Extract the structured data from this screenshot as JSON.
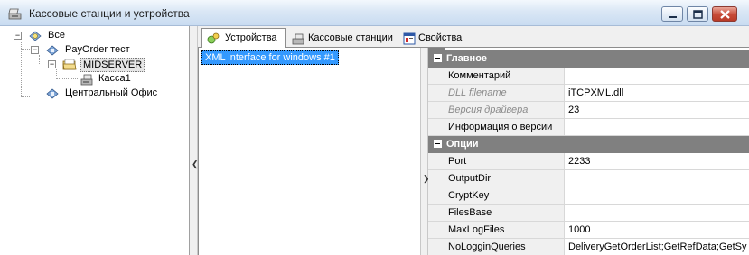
{
  "window": {
    "title": "Кассовые станции и устройства",
    "icon": "cash-register-icon"
  },
  "tree": {
    "root": {
      "label": "Все",
      "icon": "network-icon",
      "expanded": true
    },
    "payorder": {
      "label": "PayOrder тест",
      "icon": "station-icon",
      "expanded": true
    },
    "midserver": {
      "label": "MIDSERVER",
      "icon": "folder-icon",
      "expanded": true
    },
    "kassa": {
      "label": "Касса1",
      "icon": "cash-register-icon"
    },
    "office": {
      "label": "Центральный Офис",
      "icon": "station-icon"
    }
  },
  "tabs": [
    {
      "label": "Устройства",
      "icon": "devices-icon",
      "active": true
    },
    {
      "label": "Кассовые станции",
      "icon": "cash-register-icon",
      "active": false
    },
    {
      "label": "Свойства",
      "icon": "properties-icon",
      "active": false
    }
  ],
  "devices": [
    {
      "label": "XML interface for windows #1",
      "selected": true
    }
  ],
  "properties": {
    "main": {
      "category": "Главное",
      "rows": [
        {
          "name": "Комментарий",
          "value": "",
          "readonly": false
        },
        {
          "name": "DLL filename",
          "value": "iTCPXML.dll",
          "readonly": true
        },
        {
          "name": "Версия драйвера",
          "value": "23",
          "readonly": true
        },
        {
          "name": "Информация о версии",
          "value": "",
          "readonly": false
        }
      ]
    },
    "options": {
      "category": "Опции",
      "rows": [
        {
          "name": "Port",
          "value": "2233",
          "readonly": false
        },
        {
          "name": "OutputDir",
          "value": "",
          "readonly": false
        },
        {
          "name": "CryptKey",
          "value": "",
          "readonly": false
        },
        {
          "name": "FilesBase",
          "value": "",
          "readonly": false
        },
        {
          "name": "MaxLogFiles",
          "value": "1000",
          "readonly": false
        },
        {
          "name": "NoLogginQueries",
          "value": "DeliveryGetOrderList;GetRefData;GetSy",
          "readonly": false
        }
      ]
    }
  },
  "colors": {
    "selection": "#3399ff",
    "category": "#808080",
    "titlebar": "#dae7f5"
  }
}
